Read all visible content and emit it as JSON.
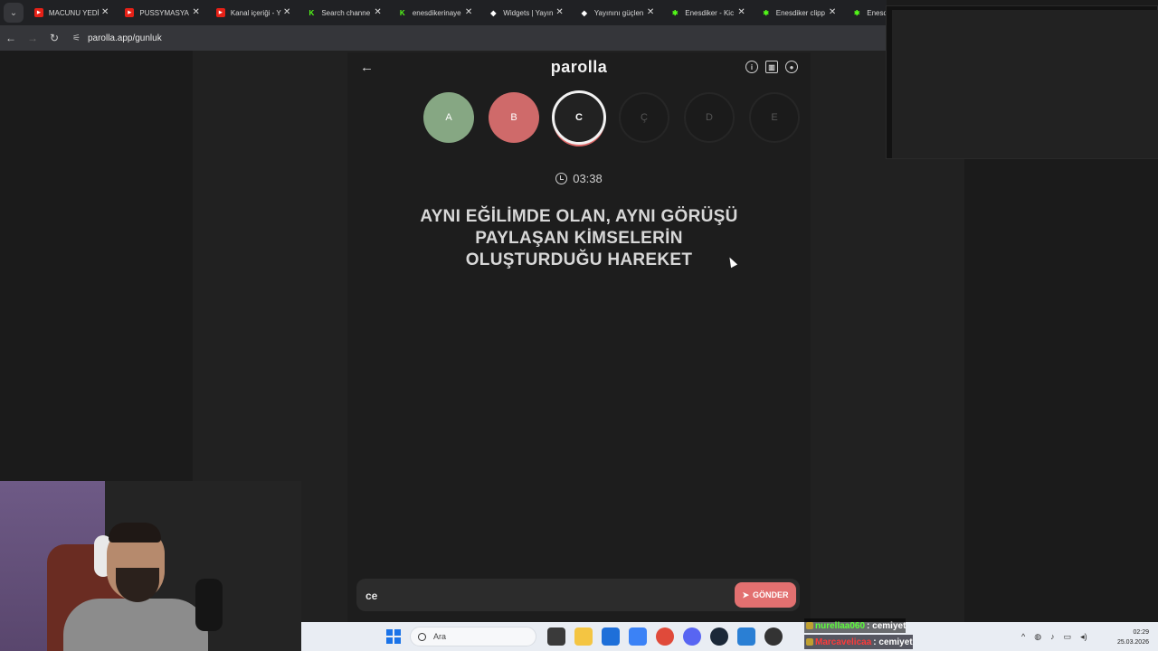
{
  "browser": {
    "tabs": [
      {
        "title": "MACUNU YEDİ",
        "icon": "youtube-icon"
      },
      {
        "title": "PUSSYMASYA",
        "icon": "youtube-icon"
      },
      {
        "title": "Kanal içeriği - Y",
        "icon": "youtube-studio-icon"
      },
      {
        "title": "Search channe",
        "icon": "kick-icon"
      },
      {
        "title": "enesdikerinaye",
        "icon": "kick-icon"
      },
      {
        "title": "Widgets | Yayın",
        "icon": "diamond-icon"
      },
      {
        "title": "Yayınını güçlen",
        "icon": "diamond-icon"
      },
      {
        "title": "Enesdiker - Kic",
        "icon": "kick-icon"
      },
      {
        "title": "Enesdiker clipp",
        "icon": "kick-icon"
      },
      {
        "title": "Enesdi",
        "icon": "kick-icon"
      }
    ],
    "url": "parolla.app/gunluk"
  },
  "app": {
    "brand": "parolla",
    "letters": [
      {
        "label": "A",
        "state": "correct"
      },
      {
        "label": "B",
        "state": "wrong"
      },
      {
        "label": "C",
        "state": "active"
      },
      {
        "label": "Ç",
        "state": "pending"
      },
      {
        "label": "D",
        "state": "pending"
      },
      {
        "label": "E",
        "state": "pending"
      }
    ],
    "timer": "03:38",
    "question_lines": [
      "AYNI EĞİLİMDE OLAN, AYNI GÖRÜŞÜ",
      "PAYLAŞAN KİMSELERİN",
      "OLUŞTURDUĞU HAREKET"
    ],
    "answer_value": "ce",
    "send_label": "GÖNDER"
  },
  "taskbar": {
    "search_placeholder": "Ara",
    "time": "02:29",
    "date": "25.03.2026"
  },
  "chat": [
    {
      "user": "nurellaa060",
      "message": ": cemiyet"
    },
    {
      "user": "Marcavelicaa",
      "message": ": cemiyet"
    }
  ],
  "colors": {
    "correct": "#86a783",
    "wrong": "#cf6a6a",
    "send": "#e27070",
    "background": "#1d1d1d"
  }
}
